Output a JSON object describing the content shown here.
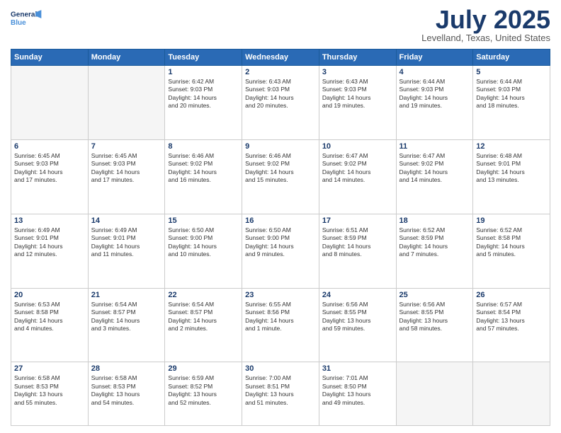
{
  "logo": {
    "line1": "General",
    "line2": "Blue"
  },
  "title": "July 2025",
  "location": "Levelland, Texas, United States",
  "days_header": [
    "Sunday",
    "Monday",
    "Tuesday",
    "Wednesday",
    "Thursday",
    "Friday",
    "Saturday"
  ],
  "weeks": [
    [
      {
        "day": "",
        "info": ""
      },
      {
        "day": "",
        "info": ""
      },
      {
        "day": "1",
        "info": "Sunrise: 6:42 AM\nSunset: 9:03 PM\nDaylight: 14 hours\nand 20 minutes."
      },
      {
        "day": "2",
        "info": "Sunrise: 6:43 AM\nSunset: 9:03 PM\nDaylight: 14 hours\nand 20 minutes."
      },
      {
        "day": "3",
        "info": "Sunrise: 6:43 AM\nSunset: 9:03 PM\nDaylight: 14 hours\nand 19 minutes."
      },
      {
        "day": "4",
        "info": "Sunrise: 6:44 AM\nSunset: 9:03 PM\nDaylight: 14 hours\nand 19 minutes."
      },
      {
        "day": "5",
        "info": "Sunrise: 6:44 AM\nSunset: 9:03 PM\nDaylight: 14 hours\nand 18 minutes."
      }
    ],
    [
      {
        "day": "6",
        "info": "Sunrise: 6:45 AM\nSunset: 9:03 PM\nDaylight: 14 hours\nand 17 minutes."
      },
      {
        "day": "7",
        "info": "Sunrise: 6:45 AM\nSunset: 9:03 PM\nDaylight: 14 hours\nand 17 minutes."
      },
      {
        "day": "8",
        "info": "Sunrise: 6:46 AM\nSunset: 9:02 PM\nDaylight: 14 hours\nand 16 minutes."
      },
      {
        "day": "9",
        "info": "Sunrise: 6:46 AM\nSunset: 9:02 PM\nDaylight: 14 hours\nand 15 minutes."
      },
      {
        "day": "10",
        "info": "Sunrise: 6:47 AM\nSunset: 9:02 PM\nDaylight: 14 hours\nand 14 minutes."
      },
      {
        "day": "11",
        "info": "Sunrise: 6:47 AM\nSunset: 9:02 PM\nDaylight: 14 hours\nand 14 minutes."
      },
      {
        "day": "12",
        "info": "Sunrise: 6:48 AM\nSunset: 9:01 PM\nDaylight: 14 hours\nand 13 minutes."
      }
    ],
    [
      {
        "day": "13",
        "info": "Sunrise: 6:49 AM\nSunset: 9:01 PM\nDaylight: 14 hours\nand 12 minutes."
      },
      {
        "day": "14",
        "info": "Sunrise: 6:49 AM\nSunset: 9:01 PM\nDaylight: 14 hours\nand 11 minutes."
      },
      {
        "day": "15",
        "info": "Sunrise: 6:50 AM\nSunset: 9:00 PM\nDaylight: 14 hours\nand 10 minutes."
      },
      {
        "day": "16",
        "info": "Sunrise: 6:50 AM\nSunset: 9:00 PM\nDaylight: 14 hours\nand 9 minutes."
      },
      {
        "day": "17",
        "info": "Sunrise: 6:51 AM\nSunset: 8:59 PM\nDaylight: 14 hours\nand 8 minutes."
      },
      {
        "day": "18",
        "info": "Sunrise: 6:52 AM\nSunset: 8:59 PM\nDaylight: 14 hours\nand 7 minutes."
      },
      {
        "day": "19",
        "info": "Sunrise: 6:52 AM\nSunset: 8:58 PM\nDaylight: 14 hours\nand 5 minutes."
      }
    ],
    [
      {
        "day": "20",
        "info": "Sunrise: 6:53 AM\nSunset: 8:58 PM\nDaylight: 14 hours\nand 4 minutes."
      },
      {
        "day": "21",
        "info": "Sunrise: 6:54 AM\nSunset: 8:57 PM\nDaylight: 14 hours\nand 3 minutes."
      },
      {
        "day": "22",
        "info": "Sunrise: 6:54 AM\nSunset: 8:57 PM\nDaylight: 14 hours\nand 2 minutes."
      },
      {
        "day": "23",
        "info": "Sunrise: 6:55 AM\nSunset: 8:56 PM\nDaylight: 14 hours\nand 1 minute."
      },
      {
        "day": "24",
        "info": "Sunrise: 6:56 AM\nSunset: 8:55 PM\nDaylight: 13 hours\nand 59 minutes."
      },
      {
        "day": "25",
        "info": "Sunrise: 6:56 AM\nSunset: 8:55 PM\nDaylight: 13 hours\nand 58 minutes."
      },
      {
        "day": "26",
        "info": "Sunrise: 6:57 AM\nSunset: 8:54 PM\nDaylight: 13 hours\nand 57 minutes."
      }
    ],
    [
      {
        "day": "27",
        "info": "Sunrise: 6:58 AM\nSunset: 8:53 PM\nDaylight: 13 hours\nand 55 minutes."
      },
      {
        "day": "28",
        "info": "Sunrise: 6:58 AM\nSunset: 8:53 PM\nDaylight: 13 hours\nand 54 minutes."
      },
      {
        "day": "29",
        "info": "Sunrise: 6:59 AM\nSunset: 8:52 PM\nDaylight: 13 hours\nand 52 minutes."
      },
      {
        "day": "30",
        "info": "Sunrise: 7:00 AM\nSunset: 8:51 PM\nDaylight: 13 hours\nand 51 minutes."
      },
      {
        "day": "31",
        "info": "Sunrise: 7:01 AM\nSunset: 8:50 PM\nDaylight: 13 hours\nand 49 minutes."
      },
      {
        "day": "",
        "info": ""
      },
      {
        "day": "",
        "info": ""
      }
    ]
  ]
}
